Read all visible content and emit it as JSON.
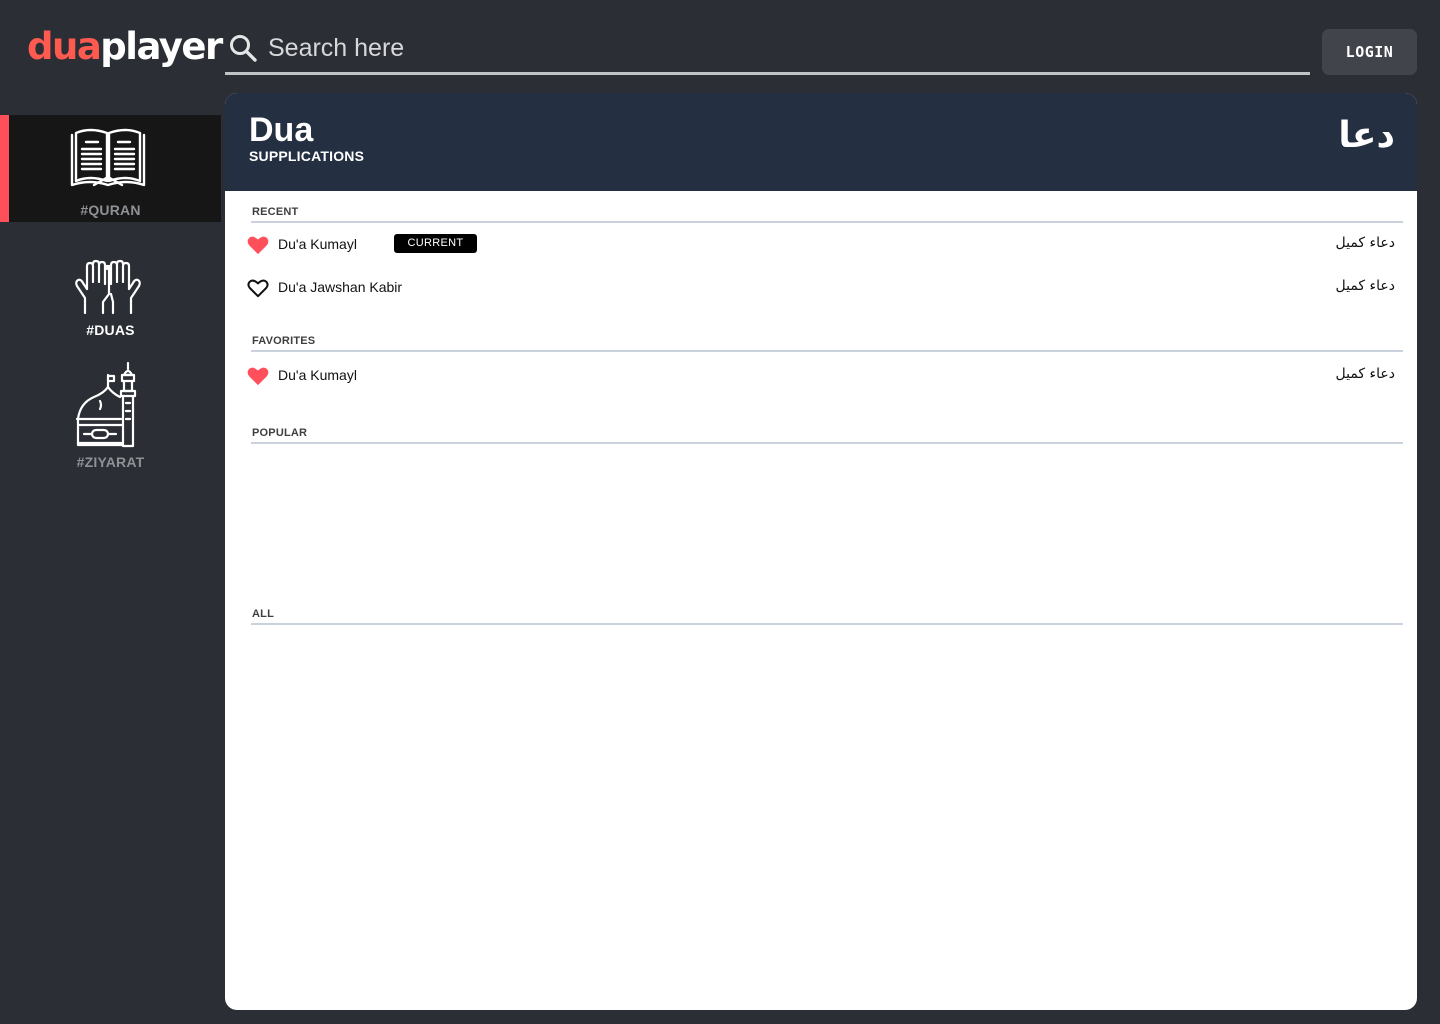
{
  "brand": {
    "logo_part1": "dua",
    "logo_part2": "player",
    "accent_color": "#ff4f5b"
  },
  "search": {
    "placeholder": "Search here",
    "icon": "search-icon"
  },
  "header": {
    "login_label": "LOGIN"
  },
  "sidebar": {
    "items": [
      {
        "label": "#QURAN",
        "icon": "quran-book-icon",
        "active": true
      },
      {
        "label": "#DUAS",
        "icon": "praying-hands-icon",
        "active": false
      },
      {
        "label": "#ZIYARAT",
        "icon": "shrine-dome-icon",
        "active": false
      }
    ]
  },
  "panel": {
    "title": "Dua",
    "subtitle": "SUPPLICATIONS",
    "arabic_title": "دعا",
    "header_color": "#243042"
  },
  "sections": {
    "recent": {
      "label": "RECENT",
      "items": [
        {
          "title": "Du'a Kumayl",
          "arabic": "دعاء كميل",
          "favorite": true,
          "badge": "CURRENT"
        },
        {
          "title": "Du'a Jawshan Kabir",
          "arabic": "دعاء كميل",
          "favorite": false
        }
      ]
    },
    "favorites": {
      "label": "FAVORITES",
      "items": [
        {
          "title": "Du'a Kumayl",
          "arabic": "دعاء كميل",
          "favorite": true
        }
      ]
    },
    "popular": {
      "label": "POPULAR",
      "items": []
    },
    "all": {
      "label": "ALL",
      "items": []
    }
  }
}
